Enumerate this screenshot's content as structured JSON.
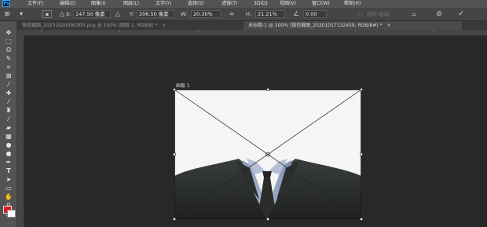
{
  "app": {
    "logo": "Ps"
  },
  "menu": [
    "文件(F)",
    "编辑(E)",
    "图像(I)",
    "图层(L)",
    "文字(Y)",
    "选择(S)",
    "滤镜(T)",
    "3D(D)",
    "视图(V)",
    "窗口(W)",
    "帮助(H)"
  ],
  "options": {
    "x_label": "X:",
    "x_value": "147.50 像素",
    "y_label": "Y:",
    "y_value": "206.50 像素",
    "w_label": "W:",
    "w_value": "20.30%",
    "h_label": "H:",
    "h_value": "21.21%",
    "angle_value": "0.00",
    "interp_label": "插补:自动"
  },
  "tabs": [
    {
      "label": "微信截图_20201020090305.png @ 100% (图层 1, RGB/8) *",
      "active": false
    },
    {
      "label": "未标题-1 @ 100% (微信截图_20201017132459, RGB/8#) *",
      "active": true
    }
  ],
  "canvas": {
    "artboard_label": "画板 1"
  },
  "swatches": {
    "foreground": "#e51c1c",
    "background": "#ffffff"
  }
}
